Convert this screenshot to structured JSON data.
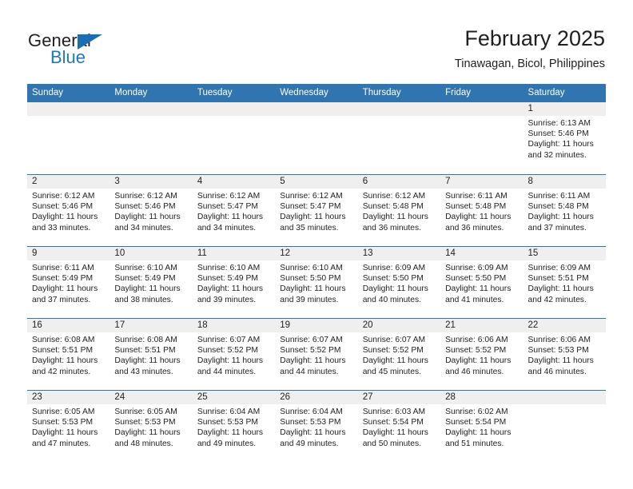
{
  "brand": {
    "name_part1": "General",
    "name_part2": "Blue",
    "triangle_color": "#1a6fb4",
    "blue_text_color": "#1a7ac4"
  },
  "header": {
    "title": "February 2025",
    "subtitle": "Tinawagan, Bicol, Philippines"
  },
  "theme": {
    "header_blue": "#3175b0",
    "day_band_gray": "#efefef",
    "text_color": "#222222"
  },
  "weekdays": [
    "Sunday",
    "Monday",
    "Tuesday",
    "Wednesday",
    "Thursday",
    "Friday",
    "Saturday"
  ],
  "weeks": [
    [
      {
        "day": "",
        "sunrise": "",
        "sunset": "",
        "daylight1": "",
        "daylight2": ""
      },
      {
        "day": "",
        "sunrise": "",
        "sunset": "",
        "daylight1": "",
        "daylight2": ""
      },
      {
        "day": "",
        "sunrise": "",
        "sunset": "",
        "daylight1": "",
        "daylight2": ""
      },
      {
        "day": "",
        "sunrise": "",
        "sunset": "",
        "daylight1": "",
        "daylight2": ""
      },
      {
        "day": "",
        "sunrise": "",
        "sunset": "",
        "daylight1": "",
        "daylight2": ""
      },
      {
        "day": "",
        "sunrise": "",
        "sunset": "",
        "daylight1": "",
        "daylight2": ""
      },
      {
        "day": "1",
        "sunrise": "Sunrise: 6:13 AM",
        "sunset": "Sunset: 5:46 PM",
        "daylight1": "Daylight: 11 hours",
        "daylight2": "and 32 minutes."
      }
    ],
    [
      {
        "day": "2",
        "sunrise": "Sunrise: 6:12 AM",
        "sunset": "Sunset: 5:46 PM",
        "daylight1": "Daylight: 11 hours",
        "daylight2": "and 33 minutes."
      },
      {
        "day": "3",
        "sunrise": "Sunrise: 6:12 AM",
        "sunset": "Sunset: 5:46 PM",
        "daylight1": "Daylight: 11 hours",
        "daylight2": "and 34 minutes."
      },
      {
        "day": "4",
        "sunrise": "Sunrise: 6:12 AM",
        "sunset": "Sunset: 5:47 PM",
        "daylight1": "Daylight: 11 hours",
        "daylight2": "and 34 minutes."
      },
      {
        "day": "5",
        "sunrise": "Sunrise: 6:12 AM",
        "sunset": "Sunset: 5:47 PM",
        "daylight1": "Daylight: 11 hours",
        "daylight2": "and 35 minutes."
      },
      {
        "day": "6",
        "sunrise": "Sunrise: 6:12 AM",
        "sunset": "Sunset: 5:48 PM",
        "daylight1": "Daylight: 11 hours",
        "daylight2": "and 36 minutes."
      },
      {
        "day": "7",
        "sunrise": "Sunrise: 6:11 AM",
        "sunset": "Sunset: 5:48 PM",
        "daylight1": "Daylight: 11 hours",
        "daylight2": "and 36 minutes."
      },
      {
        "day": "8",
        "sunrise": "Sunrise: 6:11 AM",
        "sunset": "Sunset: 5:48 PM",
        "daylight1": "Daylight: 11 hours",
        "daylight2": "and 37 minutes."
      }
    ],
    [
      {
        "day": "9",
        "sunrise": "Sunrise: 6:11 AM",
        "sunset": "Sunset: 5:49 PM",
        "daylight1": "Daylight: 11 hours",
        "daylight2": "and 37 minutes."
      },
      {
        "day": "10",
        "sunrise": "Sunrise: 6:10 AM",
        "sunset": "Sunset: 5:49 PM",
        "daylight1": "Daylight: 11 hours",
        "daylight2": "and 38 minutes."
      },
      {
        "day": "11",
        "sunrise": "Sunrise: 6:10 AM",
        "sunset": "Sunset: 5:49 PM",
        "daylight1": "Daylight: 11 hours",
        "daylight2": "and 39 minutes."
      },
      {
        "day": "12",
        "sunrise": "Sunrise: 6:10 AM",
        "sunset": "Sunset: 5:50 PM",
        "daylight1": "Daylight: 11 hours",
        "daylight2": "and 39 minutes."
      },
      {
        "day": "13",
        "sunrise": "Sunrise: 6:09 AM",
        "sunset": "Sunset: 5:50 PM",
        "daylight1": "Daylight: 11 hours",
        "daylight2": "and 40 minutes."
      },
      {
        "day": "14",
        "sunrise": "Sunrise: 6:09 AM",
        "sunset": "Sunset: 5:50 PM",
        "daylight1": "Daylight: 11 hours",
        "daylight2": "and 41 minutes."
      },
      {
        "day": "15",
        "sunrise": "Sunrise: 6:09 AM",
        "sunset": "Sunset: 5:51 PM",
        "daylight1": "Daylight: 11 hours",
        "daylight2": "and 42 minutes."
      }
    ],
    [
      {
        "day": "16",
        "sunrise": "Sunrise: 6:08 AM",
        "sunset": "Sunset: 5:51 PM",
        "daylight1": "Daylight: 11 hours",
        "daylight2": "and 42 minutes."
      },
      {
        "day": "17",
        "sunrise": "Sunrise: 6:08 AM",
        "sunset": "Sunset: 5:51 PM",
        "daylight1": "Daylight: 11 hours",
        "daylight2": "and 43 minutes."
      },
      {
        "day": "18",
        "sunrise": "Sunrise: 6:07 AM",
        "sunset": "Sunset: 5:52 PM",
        "daylight1": "Daylight: 11 hours",
        "daylight2": "and 44 minutes."
      },
      {
        "day": "19",
        "sunrise": "Sunrise: 6:07 AM",
        "sunset": "Sunset: 5:52 PM",
        "daylight1": "Daylight: 11 hours",
        "daylight2": "and 44 minutes."
      },
      {
        "day": "20",
        "sunrise": "Sunrise: 6:07 AM",
        "sunset": "Sunset: 5:52 PM",
        "daylight1": "Daylight: 11 hours",
        "daylight2": "and 45 minutes."
      },
      {
        "day": "21",
        "sunrise": "Sunrise: 6:06 AM",
        "sunset": "Sunset: 5:52 PM",
        "daylight1": "Daylight: 11 hours",
        "daylight2": "and 46 minutes."
      },
      {
        "day": "22",
        "sunrise": "Sunrise: 6:06 AM",
        "sunset": "Sunset: 5:53 PM",
        "daylight1": "Daylight: 11 hours",
        "daylight2": "and 46 minutes."
      }
    ],
    [
      {
        "day": "23",
        "sunrise": "Sunrise: 6:05 AM",
        "sunset": "Sunset: 5:53 PM",
        "daylight1": "Daylight: 11 hours",
        "daylight2": "and 47 minutes."
      },
      {
        "day": "24",
        "sunrise": "Sunrise: 6:05 AM",
        "sunset": "Sunset: 5:53 PM",
        "daylight1": "Daylight: 11 hours",
        "daylight2": "and 48 minutes."
      },
      {
        "day": "25",
        "sunrise": "Sunrise: 6:04 AM",
        "sunset": "Sunset: 5:53 PM",
        "daylight1": "Daylight: 11 hours",
        "daylight2": "and 49 minutes."
      },
      {
        "day": "26",
        "sunrise": "Sunrise: 6:04 AM",
        "sunset": "Sunset: 5:53 PM",
        "daylight1": "Daylight: 11 hours",
        "daylight2": "and 49 minutes."
      },
      {
        "day": "27",
        "sunrise": "Sunrise: 6:03 AM",
        "sunset": "Sunset: 5:54 PM",
        "daylight1": "Daylight: 11 hours",
        "daylight2": "and 50 minutes."
      },
      {
        "day": "28",
        "sunrise": "Sunrise: 6:02 AM",
        "sunset": "Sunset: 5:54 PM",
        "daylight1": "Daylight: 11 hours",
        "daylight2": "and 51 minutes."
      },
      {
        "day": "",
        "sunrise": "",
        "sunset": "",
        "daylight1": "",
        "daylight2": ""
      }
    ]
  ]
}
